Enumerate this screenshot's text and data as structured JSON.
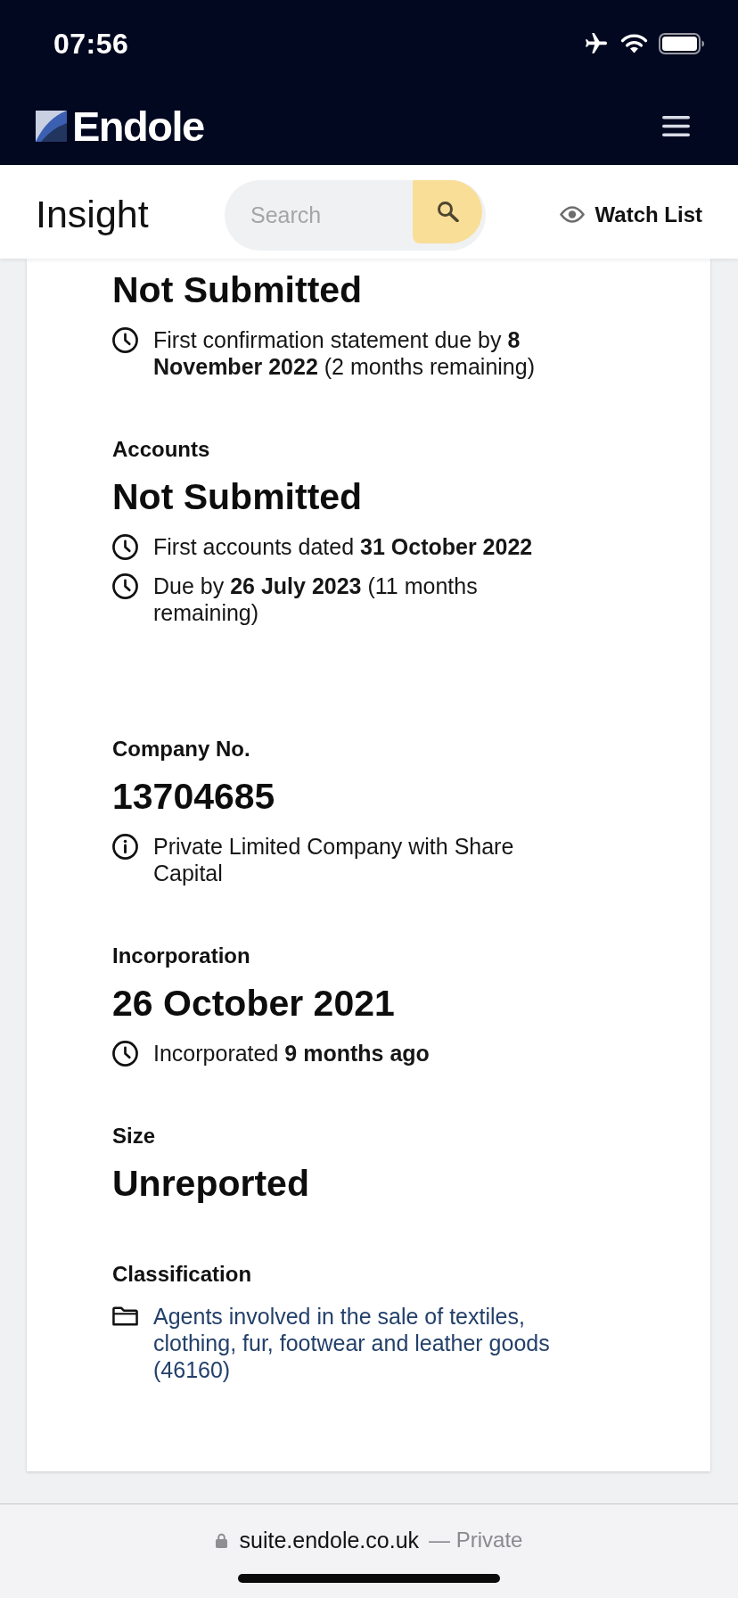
{
  "status_bar": {
    "time": "07:56"
  },
  "header": {
    "logo_text": "Endole"
  },
  "toolbar": {
    "title": "Insight",
    "search": {
      "placeholder": "Search"
    },
    "watch_list": "Watch List"
  },
  "groups": [
    {
      "sections": [
        {
          "value": "Not Submitted",
          "notes": [
            {
              "kind": "date",
              "text": "First confirmation statement due by **8 November 2022** (2 months remaining)"
            }
          ]
        },
        {
          "label": "Accounts",
          "value": "Not Submitted",
          "notes": [
            {
              "kind": "date",
              "text": "First accounts dated **31 October 2022**"
            },
            {
              "kind": "date",
              "text": "Due by **26 July 2023** (11 months remaining)"
            }
          ]
        }
      ]
    },
    {
      "sections": [
        {
          "label": "Company No.",
          "value": "13704685",
          "notes": [
            {
              "kind": "info",
              "text": "Private Limited Company with Share Capital"
            }
          ]
        },
        {
          "label": "Incorporation",
          "value": "26 October 2021",
          "notes": [
            {
              "kind": "date",
              "text": "Incorporated **9 months ago**"
            }
          ]
        },
        {
          "label": "Size",
          "value": "Unreported"
        },
        {
          "label": "Classification",
          "notes": [
            {
              "kind": "link",
              "text": "Agents involved in the sale of textiles, clothing, fur, footwear and leather goods (46160)"
            }
          ]
        }
      ]
    }
  ],
  "browser_bar": {
    "domain": "suite.endole.co.uk",
    "suffix": "— Private"
  }
}
